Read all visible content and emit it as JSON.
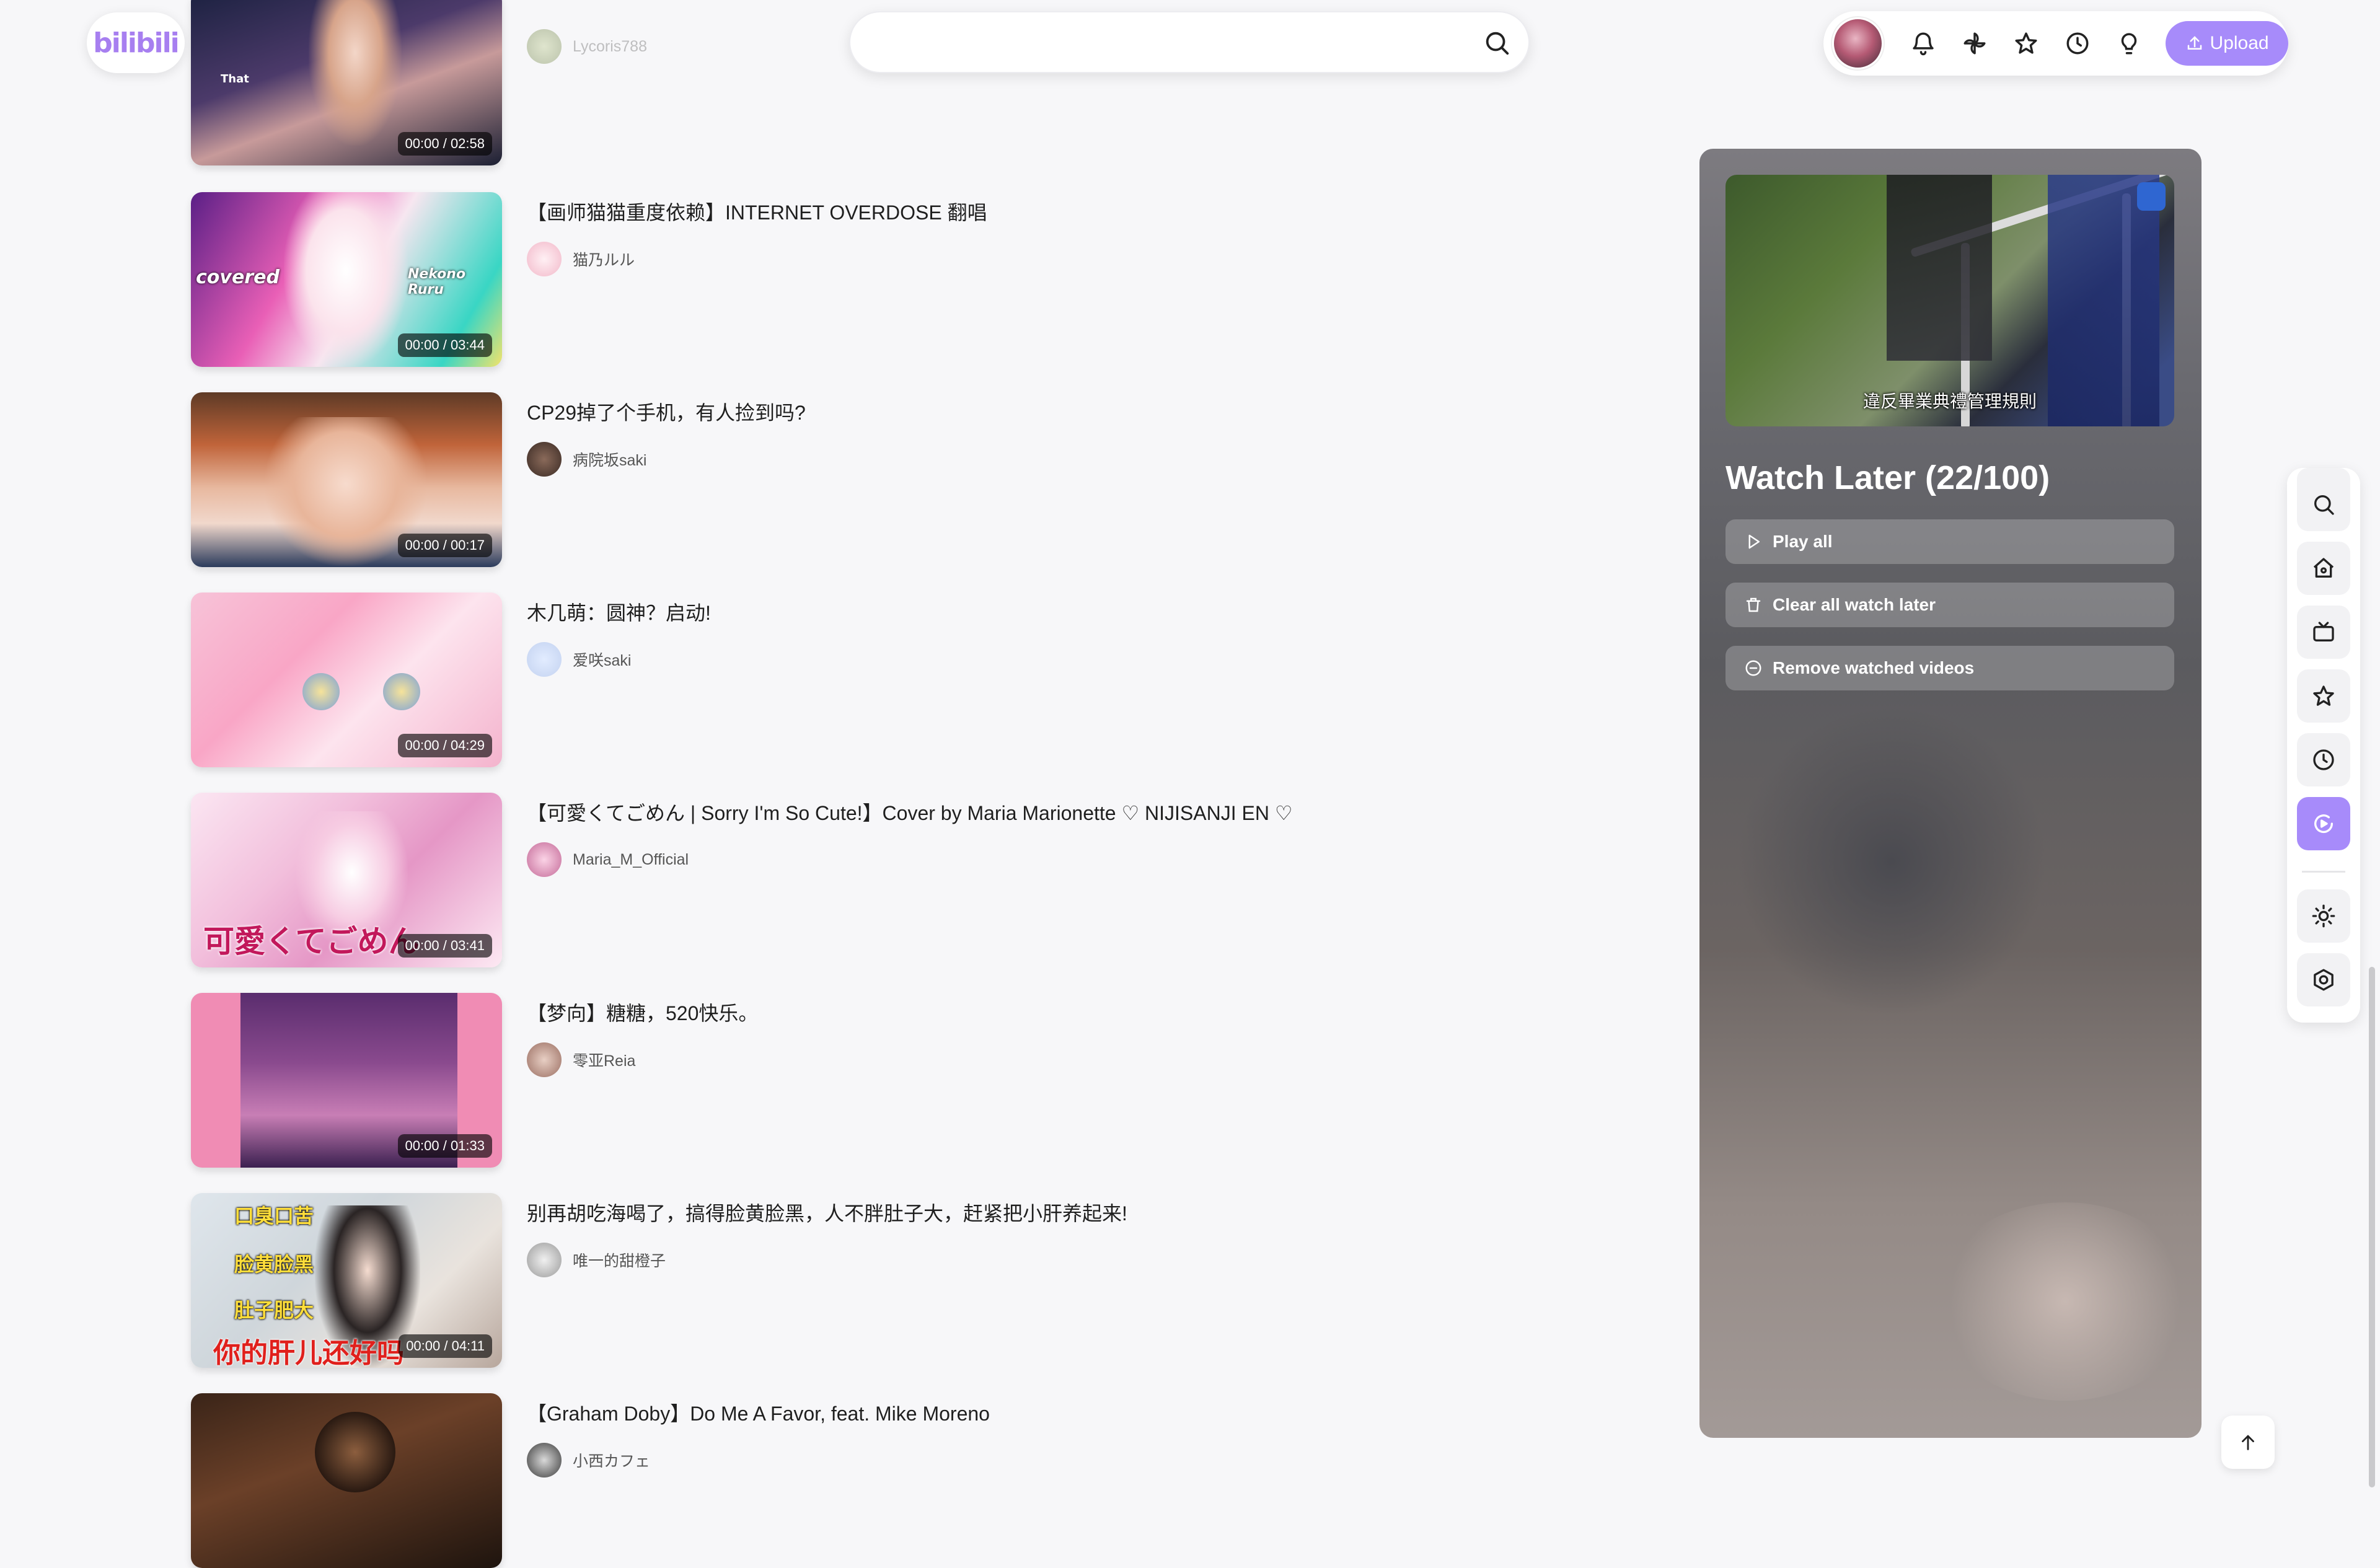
{
  "app": {
    "logo": "bilibili"
  },
  "search": {
    "placeholder": "",
    "value": ""
  },
  "topbar": {
    "upload_label": "Upload"
  },
  "videos": [
    {
      "title": "",
      "uploader": "Lycoris788",
      "time": "00:00 / 02:58",
      "caption": "That"
    },
    {
      "title": "【画师猫猫重度依赖】INTERNET OVERDOSE 翻唱",
      "uploader": "猫乃ルル",
      "time": "00:00 / 03:44",
      "caption": "covered",
      "caption2": "Nekono Ruru"
    },
    {
      "title": "CP29掉了个手机，有人捡到吗?",
      "uploader": "病院坂saki",
      "time": "00:00 / 00:17"
    },
    {
      "title": "木几萌：圆神？启动!",
      "uploader": "爱咲saki",
      "time": "00:00 / 04:29"
    },
    {
      "title": "【可愛くてごめん | Sorry I'm So Cute!】Cover by Maria Marionette ♡ NIJISANJI EN ♡",
      "uploader": "Maria_M_Official",
      "time": "00:00 / 03:41",
      "caption": "可愛くてごめん"
    },
    {
      "title": "【梦向】糖糖，520快乐。",
      "uploader": "零亚Reia",
      "time": "00:00 / 01:33"
    },
    {
      "title": "别再胡吃海喝了，搞得脸黄脸黑，人不胖肚子大，赶紧把小肝养起来!",
      "uploader": "唯一的甜橙子",
      "time": "00:00 / 04:11",
      "cap_a": "口臭口苦",
      "cap_b": "脸黄脸黑",
      "cap_c": "肚子肥大",
      "cap_d": "你的肝儿还好吗"
    },
    {
      "title": "【Graham Doby】Do Me A Favor, feat. Mike Moreno",
      "uploader": "小西カフェ",
      "time": ""
    }
  ],
  "watch_later": {
    "title": "Watch Later (22/100)",
    "cover_subtitle": "違反畢業典禮管理規則",
    "play_all": "Play all",
    "clear_all": "Clear all watch later",
    "remove_watched": "Remove watched videos"
  },
  "colors": {
    "accent": "#a78bfa",
    "text": "#1f1f1f",
    "muted": "#555555"
  }
}
